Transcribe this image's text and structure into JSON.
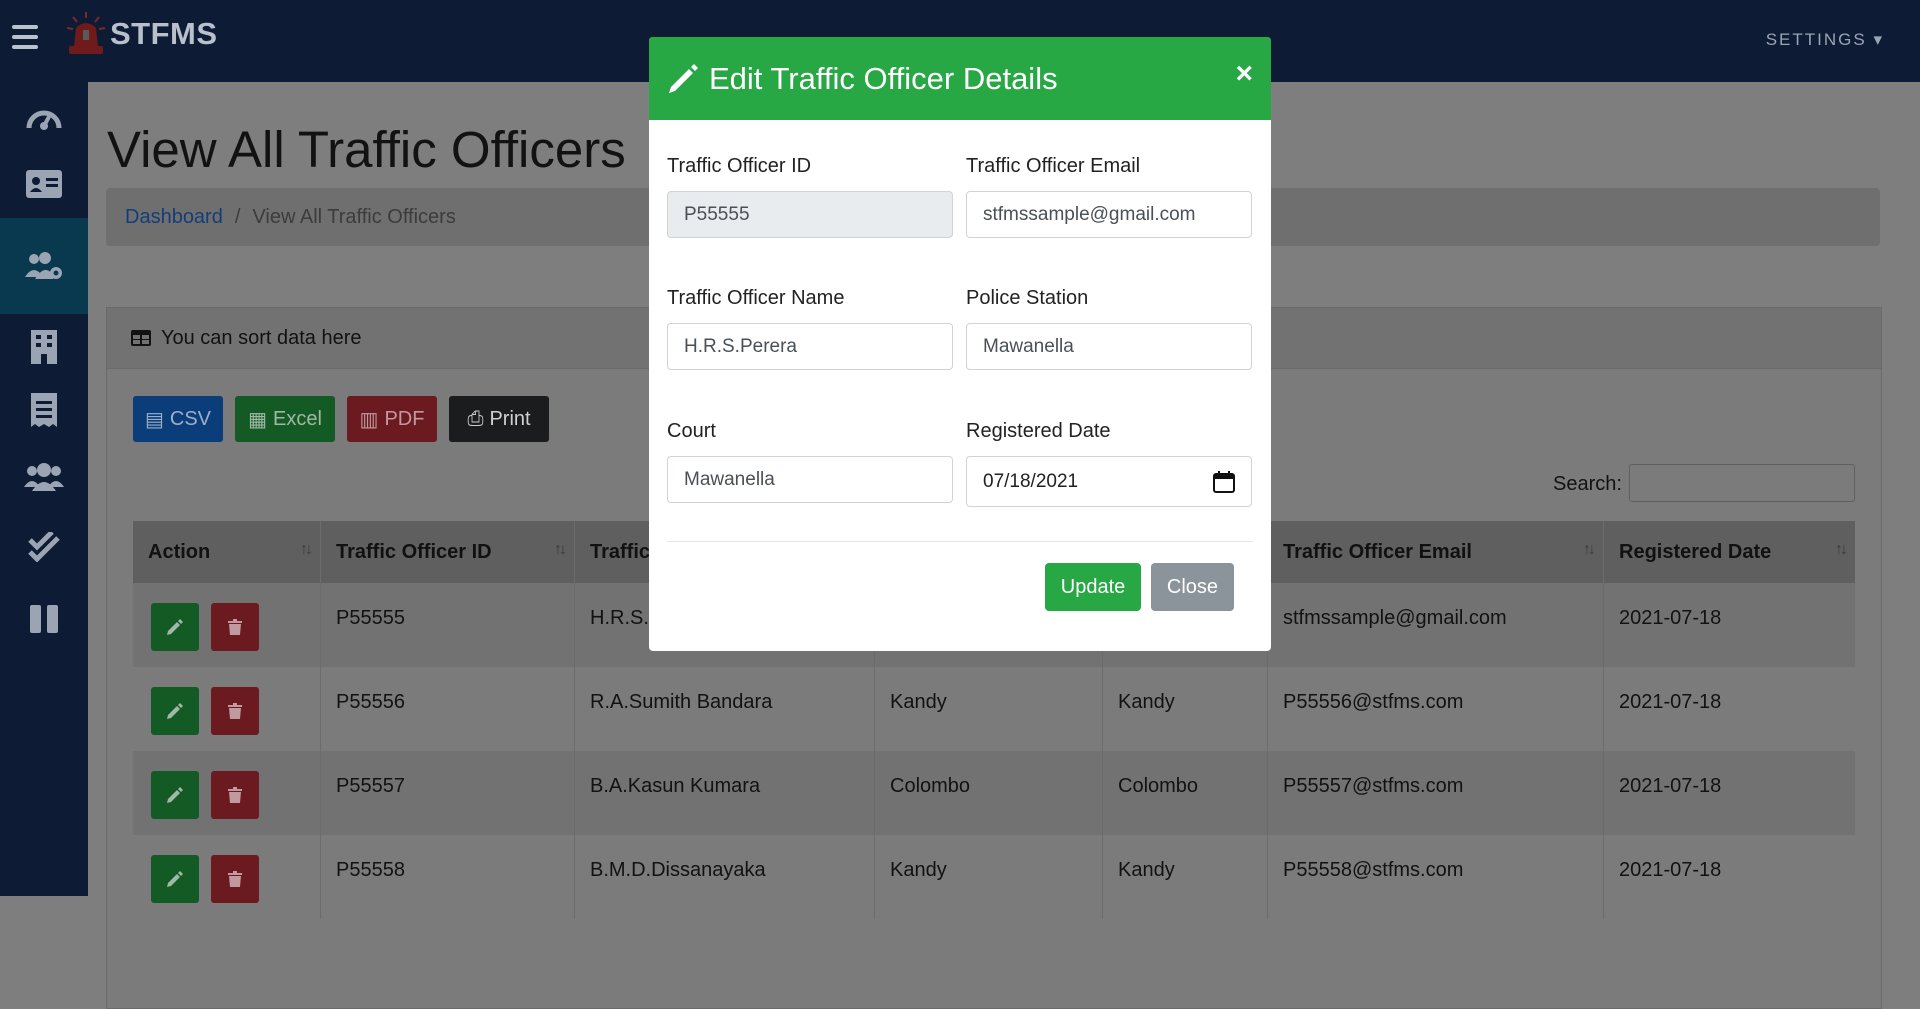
{
  "app": {
    "brand": "STFMS",
    "settings_label": "SETTINGS"
  },
  "sidebar": {
    "items": [
      {
        "icon": "tachometer-icon"
      },
      {
        "icon": "id-card-icon"
      },
      {
        "icon": "users-cog-icon",
        "active": true
      },
      {
        "icon": "building-icon"
      },
      {
        "icon": "receipt-icon"
      },
      {
        "icon": "users-icon"
      },
      {
        "icon": "check-double-icon"
      },
      {
        "icon": "columns-icon"
      }
    ]
  },
  "page": {
    "title": "View All Traffic Officers",
    "breadcrumb": {
      "link": "Dashboard",
      "separator": "/",
      "current": "View All Traffic Officers"
    }
  },
  "card": {
    "header": "You can sort data here",
    "buttons": {
      "csv": "CSV",
      "excel": "Excel",
      "pdf": "PDF",
      "print": "Print"
    },
    "search_label": "Search:",
    "table": {
      "columns": [
        "Action",
        "Traffic Officer ID",
        "Traffic",
        "",
        "",
        "Traffic Officer Email",
        "Registered Date"
      ],
      "rows": [
        [
          "P55555",
          "H.R.S.Perera",
          "",
          "",
          "stfmssample@gmail.com",
          "2021-07-18"
        ],
        [
          "P55556",
          "R.A.Sumith Bandara",
          "Kandy",
          "Kandy",
          "P55556@stfms.com",
          "2021-07-18"
        ],
        [
          "P55557",
          "B.A.Kasun Kumara",
          "Colombo",
          "Colombo",
          "P55557@stfms.com",
          "2021-07-18"
        ],
        [
          "P55558",
          "B.M.D.Dissanayaka",
          "Kandy",
          "Kandy",
          "P55558@stfms.com",
          "2021-07-18"
        ]
      ]
    }
  },
  "modal": {
    "title": "Edit Traffic Officer Details",
    "close_symbol": "×",
    "fields": {
      "officer_id": {
        "label": "Traffic Officer ID",
        "value": "P55555"
      },
      "email": {
        "label": "Traffic Officer Email",
        "value": "stfmssample@gmail.com"
      },
      "name": {
        "label": "Traffic Officer Name",
        "value": "H.R.S.Perera"
      },
      "station": {
        "label": "Police Station",
        "value": "Mawanella"
      },
      "court": {
        "label": "Court",
        "value": "Mawanella"
      },
      "reg_date": {
        "label": "Registered Date",
        "value": "07/18/2021"
      }
    },
    "update_label": "Update",
    "close_label": "Close"
  },
  "colors": {
    "topbar": "#0d1b35",
    "modal_header": "#28a745",
    "update_button": "#28a745",
    "close_button": "#8b939b",
    "overlay": "#7e7e7e"
  }
}
